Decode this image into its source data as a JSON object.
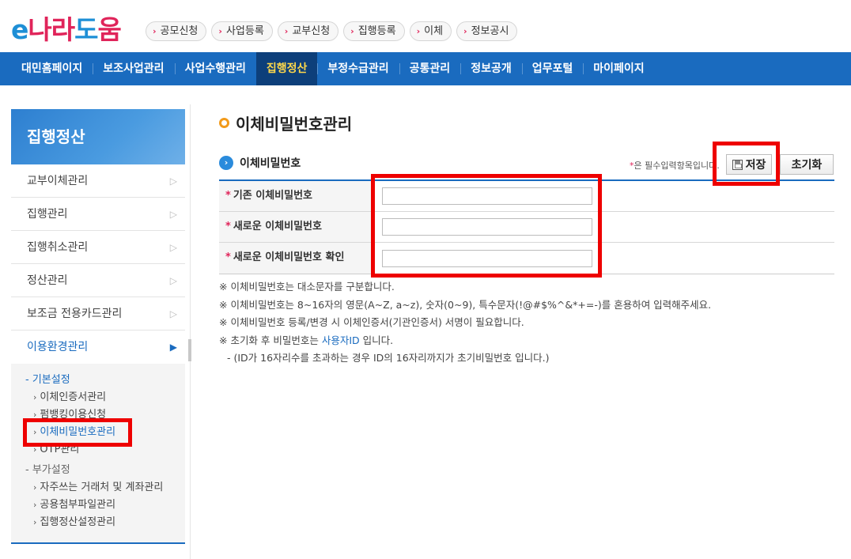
{
  "logo": {
    "e": "e",
    "na": "나",
    "ra": "라",
    "do": "도",
    "um": "움"
  },
  "quick_links": [
    "공모신청",
    "사업등록",
    "교부신청",
    "집행등록",
    "이체",
    "정보공시"
  ],
  "gnb": [
    "대민홈페이지",
    "보조사업관리",
    "사업수행관리",
    "집행정산",
    "부정수급관리",
    "공통관리",
    "정보공개",
    "업무포털",
    "마이페이지"
  ],
  "gnb_active": "집행정산",
  "lnb": {
    "title": "집행정산",
    "items": [
      "교부이체관리",
      "집행관리",
      "집행취소관리",
      "정산관리",
      "보조금 전용카드관리",
      "이용환경관리"
    ],
    "open_item": "이용환경관리",
    "groups": [
      {
        "label": "- 기본설정",
        "items": [
          "이체인증서관리",
          "펌뱅킹이용신청",
          "이체비밀번호관리",
          "OTP관리"
        ]
      },
      {
        "label": "- 부가설정",
        "items": [
          "자주쓰는 거래처 및 계좌관리",
          "공용첨부파일관리",
          "집행정산설정관리"
        ]
      }
    ],
    "active_sub": "이체비밀번호관리"
  },
  "page": {
    "title": "이체비밀번호관리",
    "section": "이체비밀번호",
    "required_note": "은 필수입력항목입니다.",
    "save_label": "저장",
    "reset_label": "초기화",
    "fields": [
      {
        "label": "기존 이체비밀번호",
        "value": ""
      },
      {
        "label": "새로운 이체비밀번호",
        "value": ""
      },
      {
        "label": "새로운 이체비밀번호 확인",
        "value": ""
      }
    ],
    "notes": [
      "※ 이체비밀번호는 대소문자를 구분합니다.",
      "※ 이체비밀번호는 8~16자의 영문(A~Z, a~z), 숫자(0~9), 특수문자(!@#$%^&*+=-)를 혼용하여 입력해주세요.",
      "※ 이체비밀번호 등록/변경 시 이체인증서(기관인증서) 서명이 필요합니다."
    ],
    "reset_note_prefix": "※ 초기화 후 비밀번호는 ",
    "reset_note_highlight": "사용자ID",
    "reset_note_suffix": " 입니다.",
    "reset_note_detail": "- (ID가 16자리수를 초과하는 경우 ID의 16자리까지가 초기비밀번호 입니다.)"
  },
  "colors": {
    "brand_blue": "#1a6bbf",
    "brand_pink": "#e0245a",
    "highlight": "#ee0000"
  }
}
